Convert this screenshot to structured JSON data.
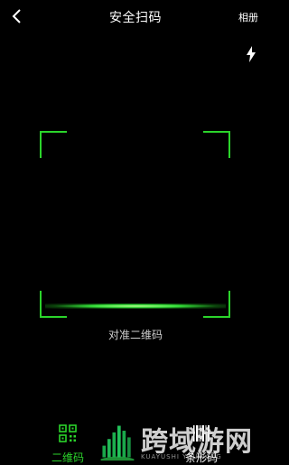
{
  "header": {
    "title": "安全扫码",
    "album_label": "相册"
  },
  "scanner": {
    "hint": "对准二维码",
    "accent_color": "#2bd42b"
  },
  "tabs": [
    {
      "label": "二维码",
      "icon": "qr-code-icon",
      "active": true
    },
    {
      "label": "条形码",
      "icon": "barcode-icon",
      "active": false
    }
  ],
  "watermark": {
    "text": "跨域游网",
    "subtext": "KUAYUSHI YOUWANG"
  }
}
